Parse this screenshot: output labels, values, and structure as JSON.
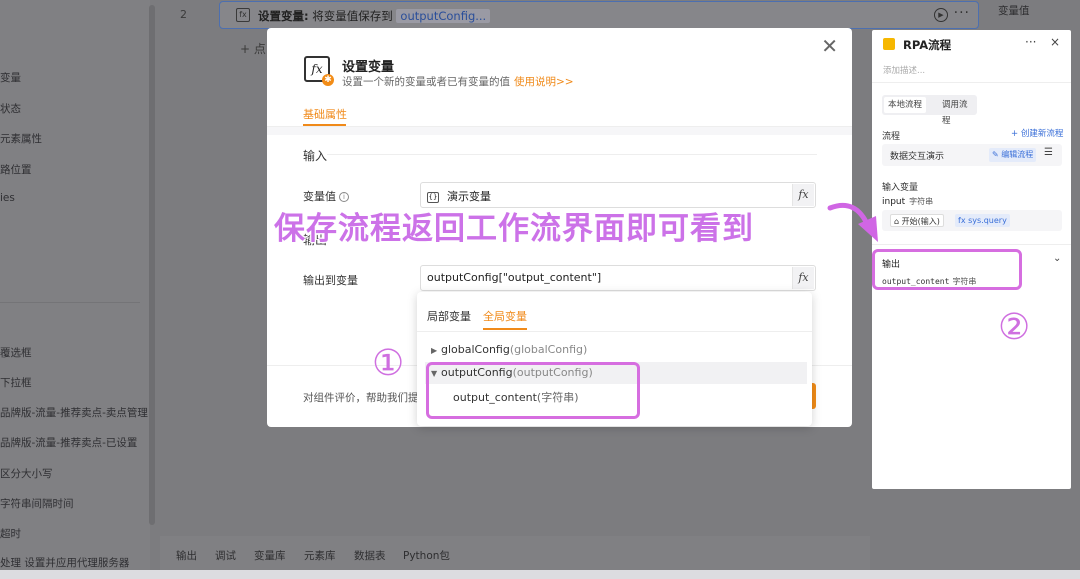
{
  "background": {
    "step_number": "2",
    "step": {
      "icon": "set-variable-icon",
      "title": "设置变量:",
      "text": "将变量值保存到",
      "chip": "outputConfig..."
    },
    "add_step_fragment": "+ 点",
    "left_items": [
      "变量",
      "状态",
      "元素属性",
      "路位置",
      "ies",
      "覆选框",
      "下拉框",
      "品牌版-流量-推荐卖点-卖点管理",
      "品牌版-流量-推荐卖点-已设置",
      "区分大小写",
      "字符串间隔时间",
      "超时",
      "处理 设置并应用代理服务器"
    ],
    "bottom_tabs": [
      "输出",
      "调试",
      "变量库",
      "元素库",
      "数据表",
      "Python包"
    ],
    "right_fragment": "变量值"
  },
  "modal": {
    "title": "设置变量",
    "subtitle": "设置一个新的变量或者已有变量的值",
    "help_link": "使用说明>>",
    "tab": "基础属性",
    "section_input": "输入",
    "section_output_partial": "输出",
    "var_value_label": "变量值",
    "var_value": "演示变量",
    "output_label": "输出到变量",
    "output_value": "outputConfig[\"output_content\"]",
    "fx": "fx",
    "footer_text": "对组件评价，帮助我们提"
  },
  "dropdown": {
    "tabs": [
      "局部变量",
      "全局变量"
    ],
    "active_tab": "全局变量",
    "items": [
      {
        "name": "globalConfig",
        "paren": "(globalConfig)",
        "expanded": false
      },
      {
        "name": "outputConfig",
        "paren": "(outputConfig)",
        "expanded": true
      }
    ],
    "child": {
      "name": "output_content",
      "paren": "(字符串)"
    }
  },
  "rpa_panel": {
    "title": "RPA流程",
    "more": "···",
    "close": "×",
    "description_placeholder": "添加描述...",
    "segment": [
      "本地流程",
      "调用流程"
    ],
    "flow_label": "流程",
    "create_link": "+ 创建新流程",
    "flow_name": "数据交互演示",
    "edit_flow": "编辑流程",
    "input_label": "输入变量",
    "input_var": "input",
    "input_type": "字符串",
    "input_tag": "开始(输入)",
    "input_query": "sys.query",
    "output_label": "输出",
    "output_var": "output_content",
    "output_type": "字符串"
  },
  "annotations": {
    "banner": "保存流程返回工作流界面即可看到",
    "marker_1": "①",
    "marker_2": "②",
    "highlight_color": "#d66ee0"
  }
}
